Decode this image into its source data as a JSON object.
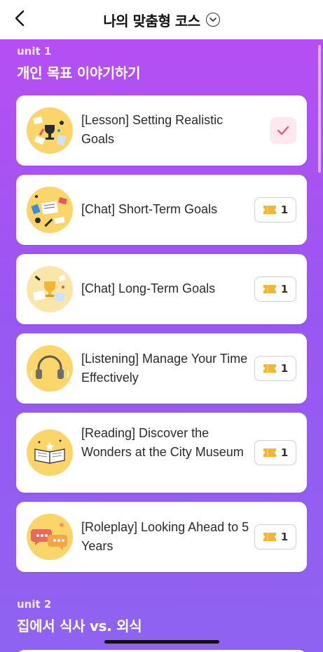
{
  "header": {
    "title": "나의 맞춤형 코스"
  },
  "units": [
    {
      "label": "unit 1",
      "title": "개인 목표 이야기하기",
      "lessons": [
        {
          "title": "[Lesson] Setting Realistic Goals",
          "status": "completed",
          "thumb_icon": "trophy-desk-icon"
        },
        {
          "title": "[Chat] Short-Term Goals",
          "ticket_count": "1",
          "thumb_icon": "study-desk-icon"
        },
        {
          "title": "[Chat] Long-Term Goals",
          "ticket_count": "1",
          "thumb_icon": "trophy-papers-icon"
        },
        {
          "title": "[Listening] Manage Your Time Effectively",
          "ticket_count": "1",
          "thumb_icon": "headphones-icon"
        },
        {
          "title": "[Reading] Discover the Wonders at the City Museum",
          "ticket_count": "1",
          "thumb_icon": "open-book-icon"
        },
        {
          "title": "[Roleplay] Looking Ahead to 5 Years",
          "ticket_count": "1",
          "thumb_icon": "speech-bubbles-icon"
        }
      ]
    },
    {
      "label": "unit 2",
      "title": "집에서 식사 vs. 외식"
    }
  ],
  "colors": {
    "gradient_top": "#b64ff3",
    "gradient_bottom": "#8f63f1",
    "thumb_bg": "#fbd46a",
    "ticket": "#f4b533",
    "check": "#e8557e"
  }
}
